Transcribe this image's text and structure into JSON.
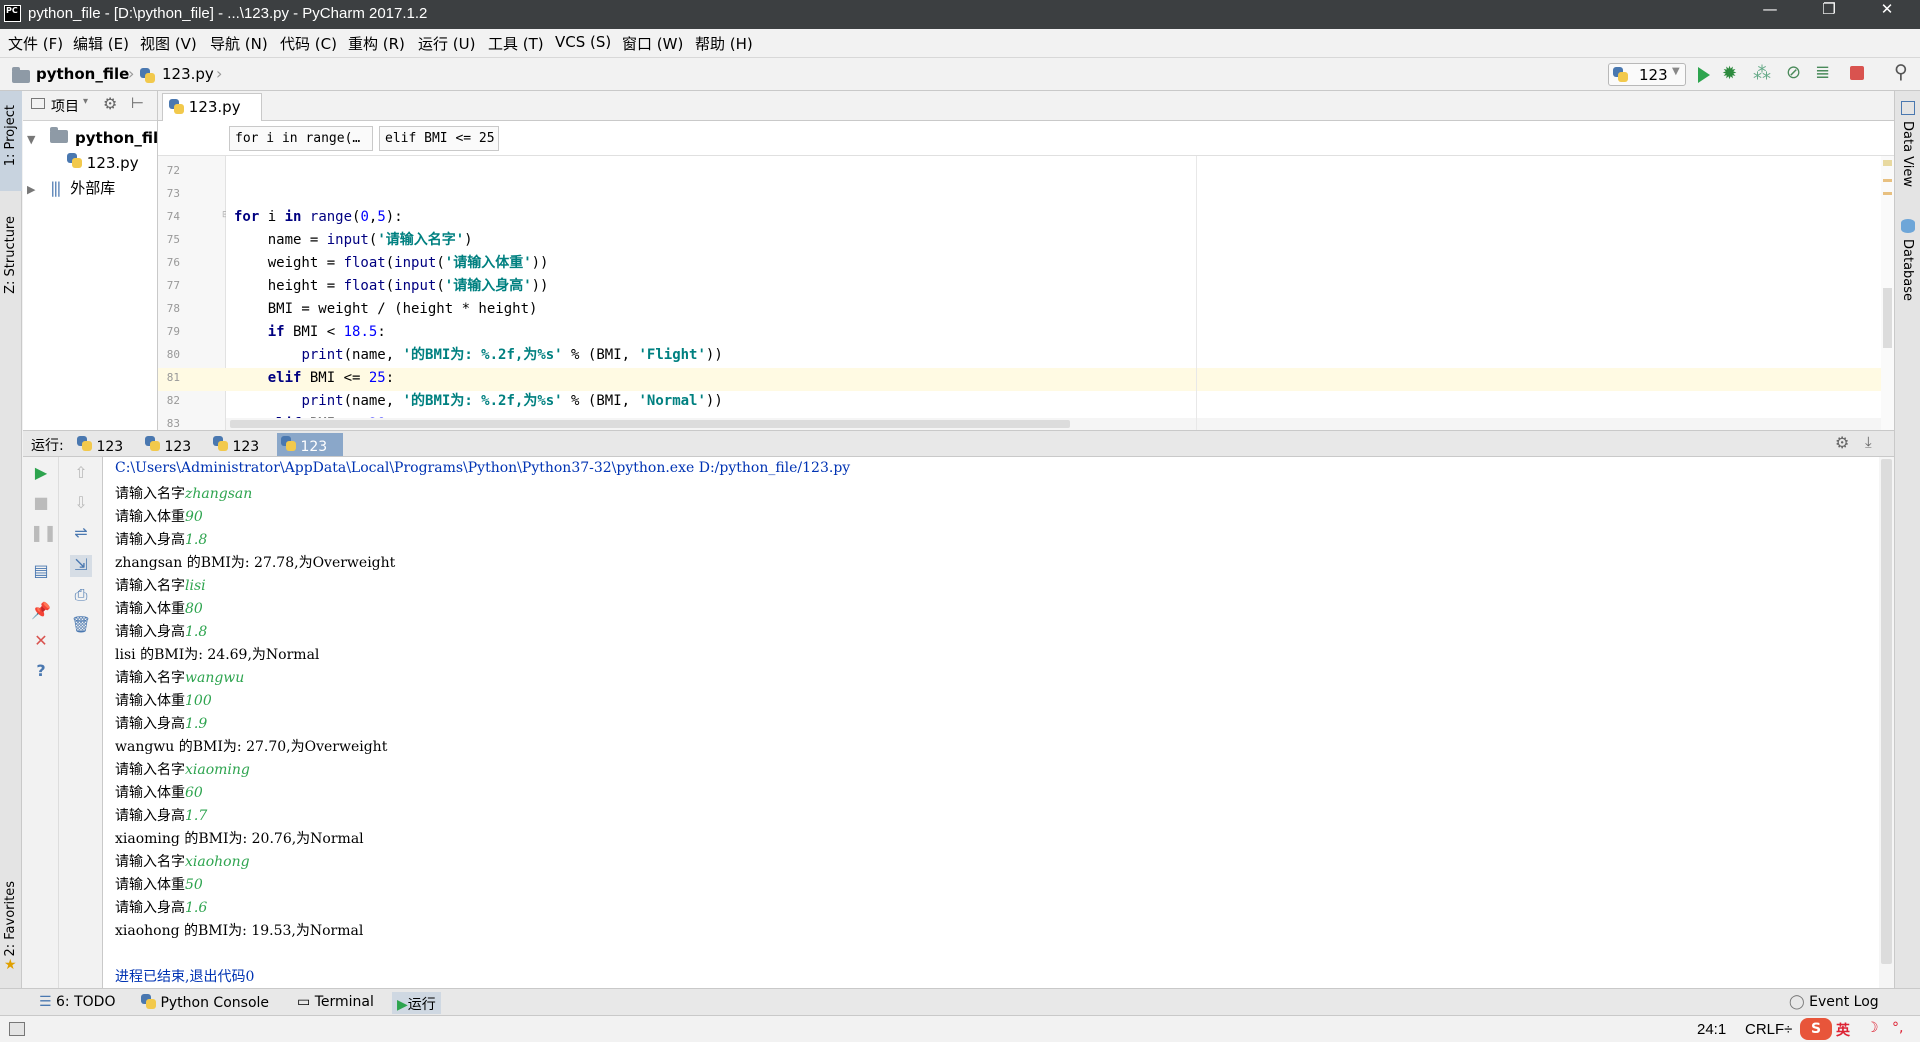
{
  "window": {
    "title": "python_file - [D:\\python_file] - ...\\123.py - PyCharm 2017.1.2",
    "logo_text": "PC",
    "minimize": "—",
    "restore": "❐",
    "close": "✕"
  },
  "menu": [
    "文件 (F)",
    "编辑 (E)",
    "视图 (V)",
    "导航 (N)",
    "代码 (C)",
    "重构 (R)",
    "运行 (U)",
    "工具 (T)",
    "VCS (S)",
    "窗口 (W)",
    "帮助 (H)"
  ],
  "nav": {
    "project": "python_file",
    "file": "123.py",
    "run_config": "123"
  },
  "side": {
    "project_tab": "1: Project",
    "structure_tab": "Z: Structure",
    "favorites_tab": "2: Favorites",
    "data_view_tab": "Data View",
    "database_tab": "Database"
  },
  "project_panel": {
    "header_label": "项目",
    "root": "python_file",
    "file": "123.py",
    "external": "外部库"
  },
  "editor": {
    "tab_label": "123.py",
    "breadcrumbs": [
      "for i in range(…",
      "elif BMI <= 25"
    ],
    "line_numbers": [
      "72",
      "73",
      "74",
      "75",
      "76",
      "77",
      "78",
      "79",
      "80",
      "81",
      "82",
      "83"
    ]
  },
  "run": {
    "label": "运行:",
    "tabs": [
      "123",
      "123",
      "123",
      "123"
    ],
    "console": [
      {
        "text": "C:\\Users\\Administrator\\AppData\\Local\\Programs\\Python\\Python37-32\\python.exe D:/python_file/123.py",
        "input": ""
      },
      {
        "text": "请输入名字",
        "input": "zhangsan"
      },
      {
        "text": "请输入体重",
        "input": "90"
      },
      {
        "text": "请输入身高",
        "input": "1.8"
      },
      {
        "text": "zhangsan 的BMI为: 27.78,为Overweight",
        "input": ""
      },
      {
        "text": "请输入名字",
        "input": "lisi"
      },
      {
        "text": "请输入体重",
        "input": "80"
      },
      {
        "text": "请输入身高",
        "input": "1.8"
      },
      {
        "text": "lisi 的BMI为: 24.69,为Normal",
        "input": ""
      },
      {
        "text": "请输入名字",
        "input": "wangwu"
      },
      {
        "text": "请输入体重",
        "input": "100"
      },
      {
        "text": "请输入身高",
        "input": "1.9"
      },
      {
        "text": "wangwu 的BMI为: 27.70,为Overweight",
        "input": ""
      },
      {
        "text": "请输入名字",
        "input": "xiaoming"
      },
      {
        "text": "请输入体重",
        "input": "60"
      },
      {
        "text": "请输入身高",
        "input": "1.7"
      },
      {
        "text": "xiaoming 的BMI为: 20.76,为Normal",
        "input": ""
      },
      {
        "text": "请输入名字",
        "input": "xiaohong"
      },
      {
        "text": "请输入体重",
        "input": "50"
      },
      {
        "text": "请输入身高",
        "input": "1.6"
      },
      {
        "text": "xiaohong 的BMI为: 19.53,为Normal",
        "input": ""
      },
      {
        "text": "",
        "input": ""
      },
      {
        "text": "进程已结束,退出代码0",
        "input": ""
      }
    ]
  },
  "bottom_tabs": {
    "todo": "6: TODO",
    "python_console": "Python Console",
    "terminal": "Terminal",
    "run": "运行",
    "event_log": "Event Log"
  },
  "status": {
    "position": "24:1",
    "line_sep": "CRLF÷"
  },
  "colors": {
    "accent_run": "#2da44e",
    "active_tab": "#8aa7c9",
    "current_line": "#fffae3"
  }
}
